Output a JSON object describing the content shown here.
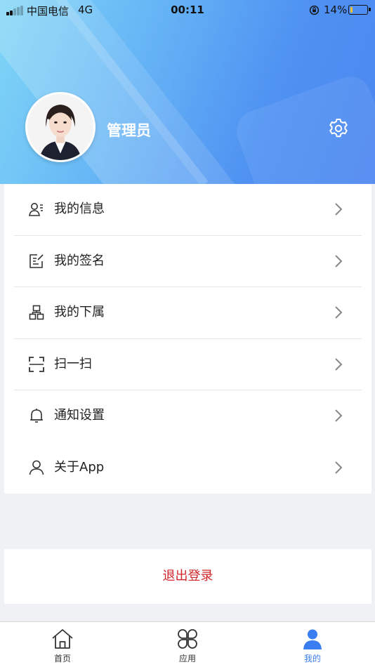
{
  "status_bar": {
    "carrier": "中国电信",
    "network": "4G",
    "time": "00:11",
    "battery_percent": "14%",
    "battery_level": 0.14,
    "icons": [
      "signal-icon",
      "orientation-lock-icon",
      "battery-icon"
    ]
  },
  "profile": {
    "name": "管理员",
    "avatar": "avatar-photo",
    "settings_icon": "gear-icon"
  },
  "menu": {
    "items": [
      {
        "label": "我的信息",
        "icon": "user-info-icon"
      },
      {
        "label": "我的签名",
        "icon": "signature-icon"
      },
      {
        "label": "我的下属",
        "icon": "org-chart-icon"
      },
      {
        "label": "扫一扫",
        "icon": "scan-icon"
      },
      {
        "label": "通知设置",
        "icon": "bell-icon"
      },
      {
        "label": "关于App",
        "icon": "user-icon"
      }
    ]
  },
  "logout": {
    "label": "退出登录"
  },
  "tabbar": {
    "tabs": [
      {
        "label": "首页",
        "icon": "home-icon",
        "active": false
      },
      {
        "label": "应用",
        "icon": "apps-icon",
        "active": false
      },
      {
        "label": "我的",
        "icon": "profile-icon",
        "active": true
      }
    ]
  },
  "colors": {
    "accent": "#3a7df0",
    "logout": "#d0262a",
    "header_gradient_start": "#7fd6f6",
    "header_gradient_end": "#4c86f0"
  }
}
